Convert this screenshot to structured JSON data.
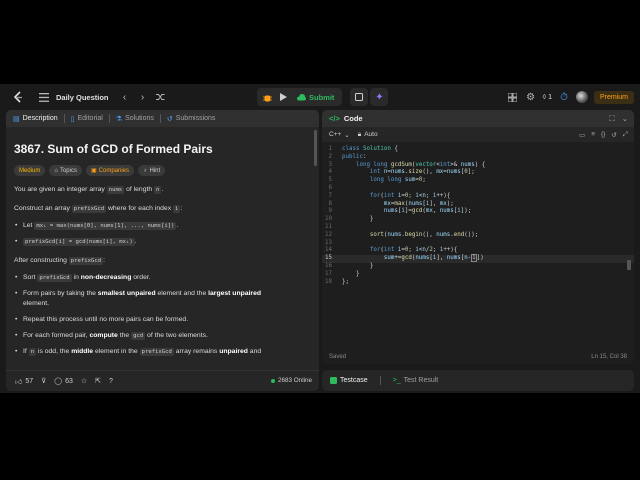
{
  "topbar": {
    "daily_label": "Daily Question",
    "submit_label": "Submit",
    "streak_count": "1",
    "premium_label": "Premium"
  },
  "tabs": [
    {
      "label": "Description",
      "icon": "document-icon"
    },
    {
      "label": "Editorial",
      "icon": "book-icon"
    },
    {
      "label": "Solutions",
      "icon": "flask-icon"
    },
    {
      "label": "Submissions",
      "icon": "history-icon"
    }
  ],
  "problem": {
    "title": "3867. Sum of GCD of Formed Pairs",
    "difficulty": "Medium",
    "topics_label": "Topics",
    "companies_label": "Companies",
    "hint_label": "Hint",
    "p1_a": "You are given an integer array ",
    "p1_code": "nums",
    "p1_b": " of length ",
    "p1_code2": "n",
    "p1_c": ".",
    "p2_a": "Construct an array ",
    "p2_code": "prefixGcd",
    "p2_b": " where for each index ",
    "p2_code2": "i",
    "p2_c": ":",
    "b1_a": "Let ",
    "b1_code": "mxᵢ = max(nums[0], nums[1], ..., nums[i])",
    "b1_b": ".",
    "b2_code": "prefixGcd[i] = gcd(nums[i], mxᵢ)",
    "b2_b": ".",
    "p3_a": "After constructing ",
    "p3_code": "prefixGcd",
    "p3_b": ":",
    "b3_a": "Sort ",
    "b3_code": "prefixGcd",
    "b3_b": " in ",
    "b3_bold": "non-decreasing",
    "b3_c": " order.",
    "b4_a": "Form pairs by taking the ",
    "b4_bold1": "smallest unpaired",
    "b4_b": " element and the ",
    "b4_bold2": "largest unpaired",
    "b4_c": "element.",
    "b5": "Repeat this process until no more pairs can be formed.",
    "b6_a": "For each formed pair, ",
    "b6_bold": "compute",
    "b6_b": " the ",
    "b6_code": "gcd",
    "b6_c": " of the two elements.",
    "b7_a": "If ",
    "b7_code": "n",
    "b7_b": " is odd, the ",
    "b7_bold": "middle",
    "b7_c": " element in the ",
    "b7_code2": "prefixGcd",
    "b7_d": " array remains ",
    "b7_bold2": "unpaired",
    "b7_e": " and"
  },
  "left_footer": {
    "likes": "57",
    "comments": "63",
    "online": "2683 Online"
  },
  "code": {
    "header": "Code",
    "language": "C++",
    "mode": "Auto",
    "status": "Saved",
    "cursor": "Ln 15, Col 38",
    "line_numbers": [
      "1",
      "2",
      "3",
      "4",
      "5",
      "6",
      "7",
      "8",
      "9",
      "10",
      "11",
      "12",
      "13",
      "14",
      "15",
      "16",
      "17",
      "18"
    ]
  },
  "testcase": {
    "testcase_label": "Testcase",
    "result_label": "Test Result"
  },
  "colors": {
    "submit": "#2cbb5d",
    "premium": "#ffa116",
    "medium": "#ffb800"
  }
}
